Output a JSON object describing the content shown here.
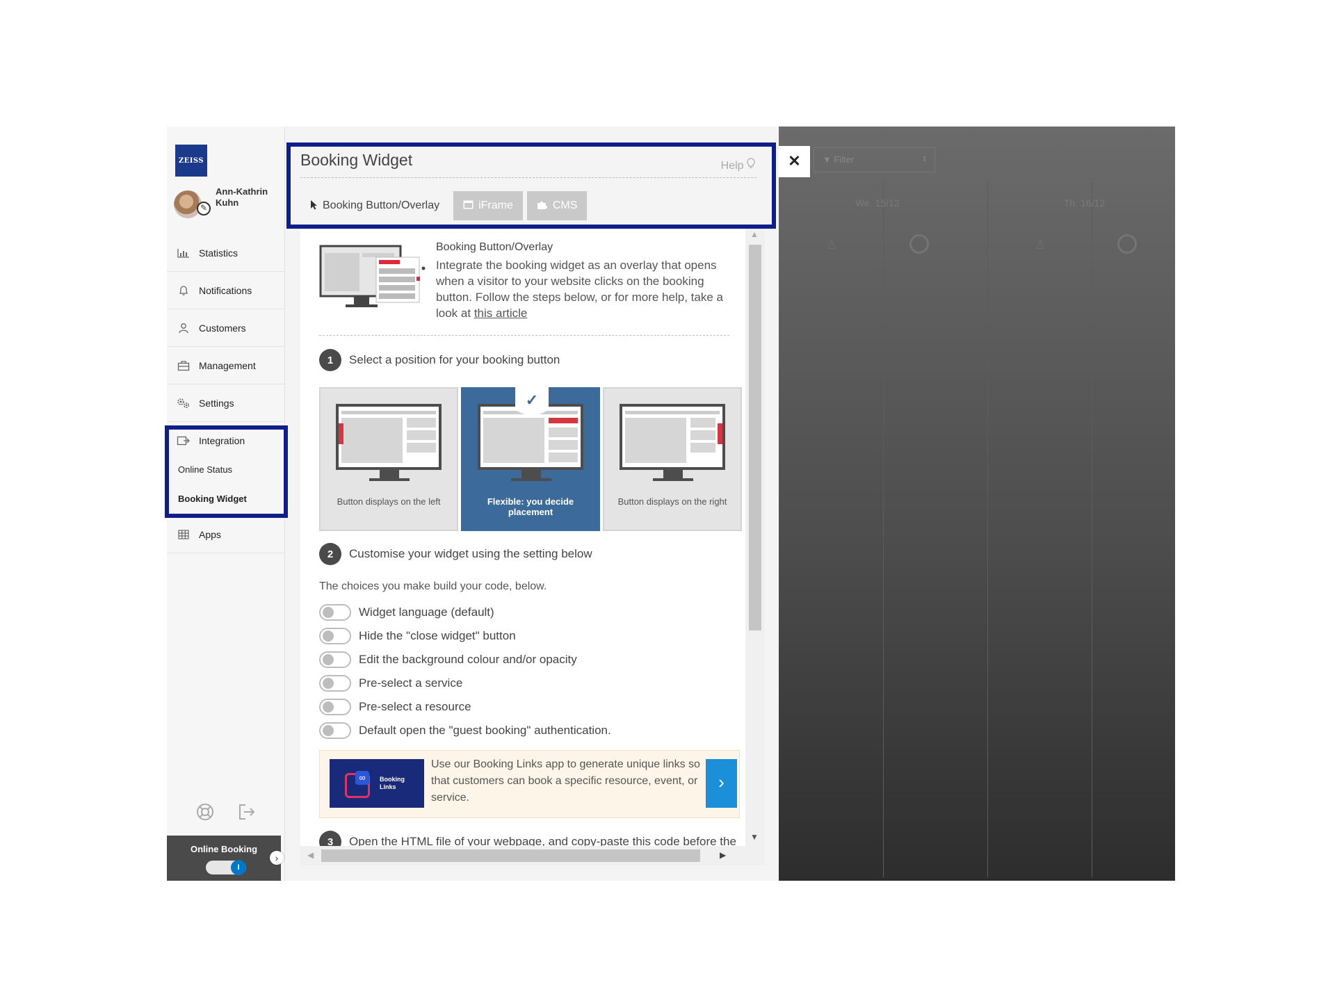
{
  "brand": {
    "logo_text": "ZEISS"
  },
  "user": {
    "name": "Ann-Kathrin Kuhn"
  },
  "sidebar": {
    "items": [
      {
        "label": "Statistics",
        "icon": "bar-chart-icon"
      },
      {
        "label": "Notifications",
        "icon": "bell-icon"
      },
      {
        "label": "Customers",
        "icon": "person-icon"
      },
      {
        "label": "Management",
        "icon": "briefcase-icon"
      },
      {
        "label": "Settings",
        "icon": "gears-icon"
      },
      {
        "label": "Integration",
        "icon": "integration-icon"
      },
      {
        "label": "Apps",
        "icon": "grid-icon"
      }
    ],
    "subitems": [
      {
        "label": "Online Status"
      },
      {
        "label": "Booking Widget",
        "active": true
      }
    ],
    "bottom_icons": [
      "lifebuoy-icon",
      "logout-icon"
    ],
    "online_booking": {
      "label": "Online Booking",
      "toggle_on": true,
      "knob_text": "I"
    }
  },
  "panel": {
    "title": "Booking Widget",
    "help": "Help",
    "tabs": [
      {
        "label": "Booking Button/Overlay",
        "icon": "cursor-icon",
        "active": true
      },
      {
        "label": "iFrame",
        "icon": "window-icon",
        "active": false
      },
      {
        "label": "CMS",
        "icon": "puzzle-icon",
        "active": false
      }
    ],
    "intro": {
      "subtitle": "Booking Button/Overlay",
      "text": "Integrate the booking widget as an overlay that opens when a visitor to your website clicks on the booking button. Follow the steps below, or for more help, take a look at ",
      "link": "this article"
    },
    "step1": {
      "number": "1",
      "text": "Select a position for your booking button",
      "options": [
        {
          "label": "Button displays on the left",
          "selected": false
        },
        {
          "label": "Flexible: you decide placement",
          "selected": true
        },
        {
          "label": "Button displays on the right",
          "selected": false
        }
      ]
    },
    "step2": {
      "number": "2",
      "text": "Customise your widget using the setting below",
      "choices_text": "The choices you make build your code, below.",
      "toggles": [
        {
          "label": "Widget language (default)",
          "on": false
        },
        {
          "label": "Hide the \"close widget\" button",
          "on": false
        },
        {
          "label": "Edit the background colour and/or opacity",
          "on": false
        },
        {
          "label": "Pre-select a service",
          "on": false
        },
        {
          "label": "Pre-select a resource",
          "on": false
        },
        {
          "label": "Default open the \"guest booking\" authentication.",
          "on": false
        }
      ]
    },
    "promo": {
      "image_text_1": "Booking",
      "image_text_2": "Links",
      "text": "Use our Booking Links app to generate unique links so that customers can book a specific resource, event, or service."
    },
    "step3": {
      "number": "3",
      "text": "Open the HTML file of your webpage, and copy-paste this code before the"
    }
  },
  "overlay": {
    "filter_label": "Filter",
    "days": [
      "We. 15/12",
      "Th. 16/12"
    ]
  },
  "colors": {
    "highlight": "#0f1f8a",
    "selected_card": "#3b6a9b",
    "promo_button": "#1b8fd9",
    "brand_blue": "#1c3a8c"
  }
}
